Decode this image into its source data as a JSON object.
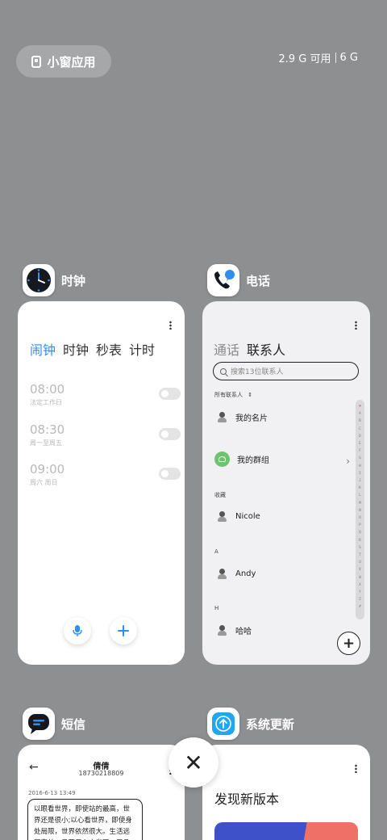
{
  "header": {
    "floating_window_label": "小窗应用",
    "memory_available": "2.9 G 可用",
    "memory_total": "6 G"
  },
  "apps": {
    "clock": {
      "name": "时钟",
      "tabs": [
        "闹钟",
        "时钟",
        "秒表",
        "计时"
      ],
      "alarms": [
        {
          "time": "08:00",
          "repeat": "法定工作日"
        },
        {
          "time": "08:30",
          "repeat": "周一至周五"
        },
        {
          "time": "09:00",
          "repeat": "周六 周日"
        }
      ]
    },
    "phone": {
      "name": "电话",
      "tabs": [
        "通话",
        "联系人"
      ],
      "search_placeholder": "搜索13位联系人",
      "all_contacts": "所有联系人",
      "my_card": "我的名片",
      "my_groups": "我的群组",
      "favorites_header": "收藏",
      "favorite_contact": "Nicole",
      "section_a": "A",
      "contact_a": "Andy",
      "section_h": "H",
      "contact_h": "哈哈",
      "index_letters": [
        "♥",
        "A",
        "B",
        "C",
        "D",
        "E",
        "F",
        "G",
        "H",
        "I",
        "J",
        "K",
        "L",
        "M",
        "N",
        "O",
        "P",
        "Q",
        "R",
        "S",
        "T",
        "U",
        "V",
        "W",
        "X",
        "Y",
        "Z",
        "#"
      ]
    },
    "sms": {
      "name": "短信",
      "contact_name": "倩倩",
      "contact_number": "18730218809",
      "date": "2016-6-13 13:49",
      "message": "以眼看世界，即使站的最高，世界还是很小;以心看世界，即使身处局限，世界依然很大。生活远不完美，只要用心去发现，平凡的也会变得伟大"
    },
    "updater": {
      "name": "系统更新",
      "heading": "发现新版本"
    }
  },
  "colors": {
    "background": "#8e8f91",
    "clock_accent": "#2f8ef0",
    "group_green": "#6cc56c"
  }
}
